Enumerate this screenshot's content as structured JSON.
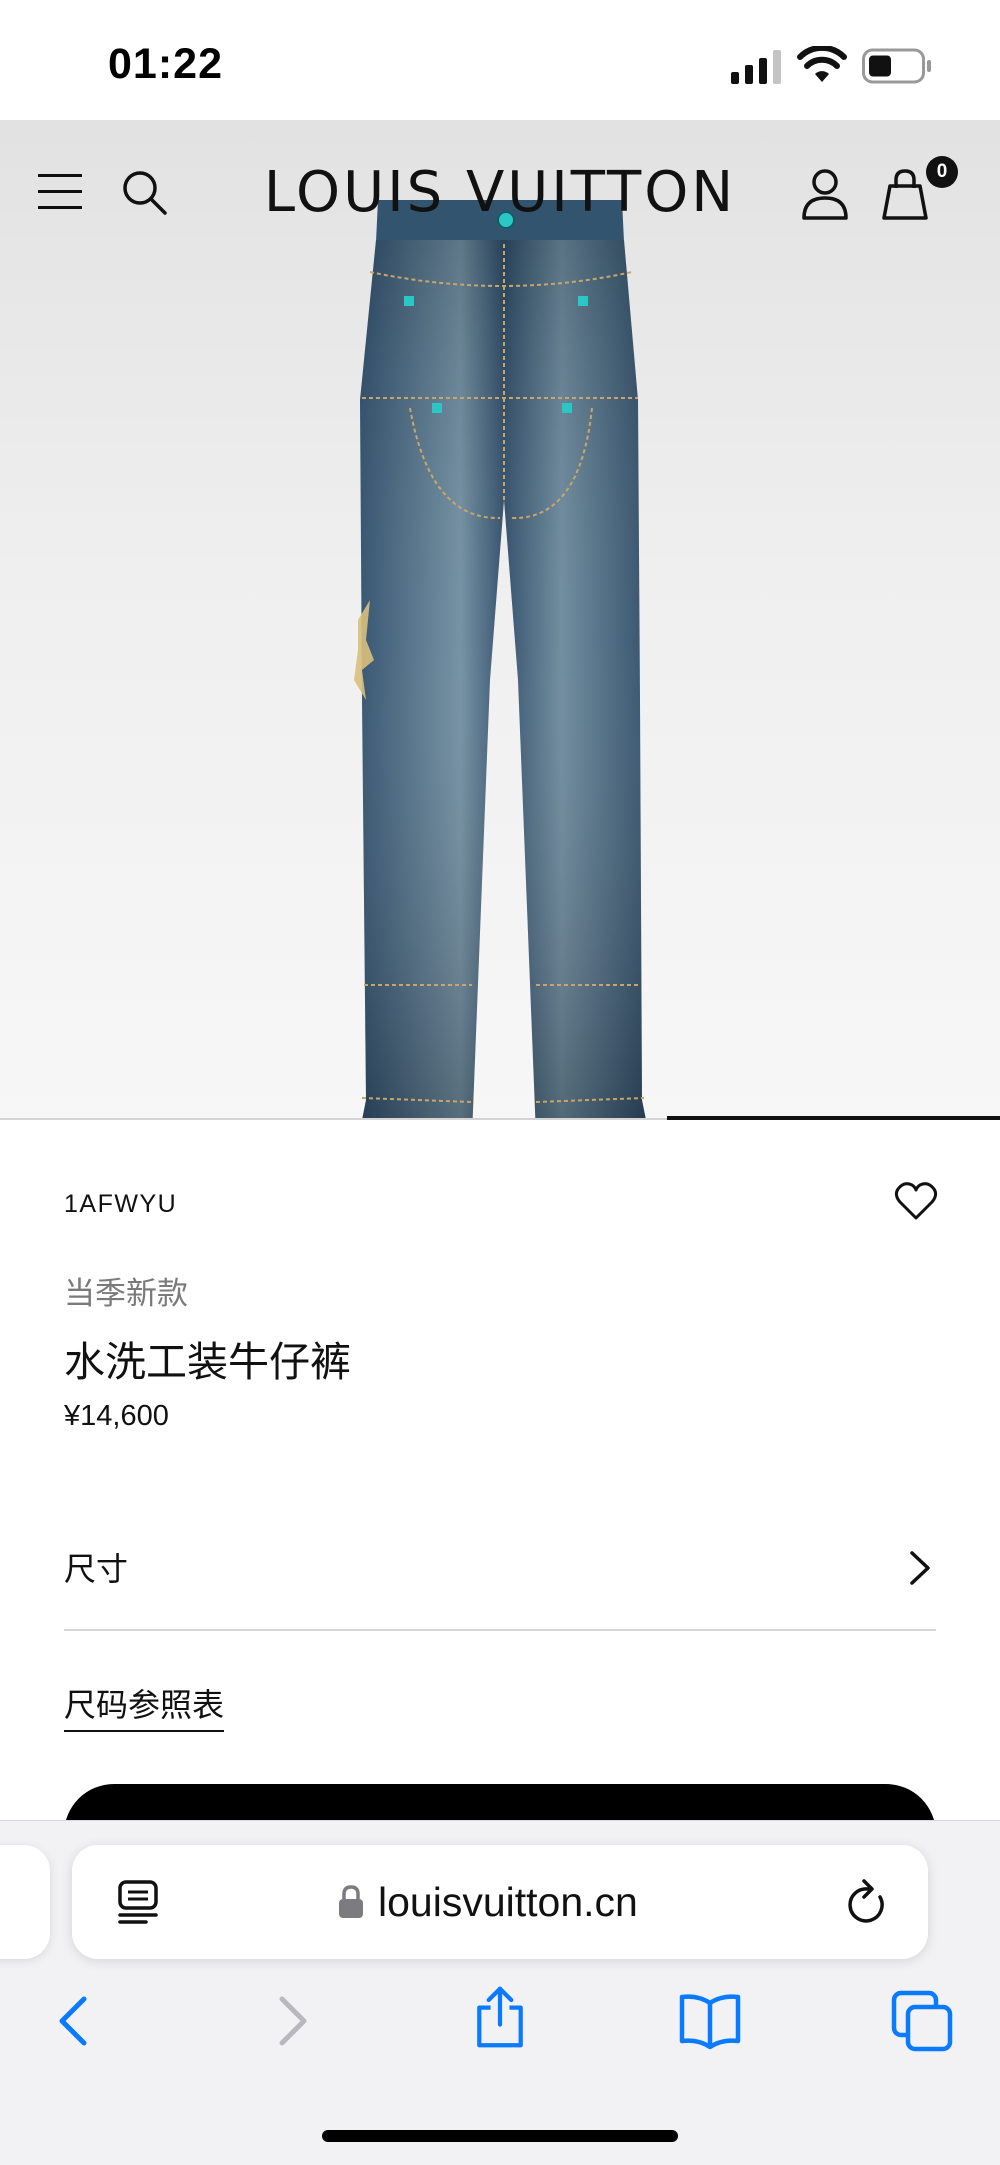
{
  "status_bar": {
    "time": "01:22"
  },
  "header": {
    "brand": "LOUIS VUITTON",
    "bag_count": "0",
    "icons": [
      "menu-icon",
      "search-icon",
      "account-icon",
      "shopping-bag-icon"
    ]
  },
  "hero": {
    "image": "denim-jeans-product-photo",
    "carousel_position": "2 of 3"
  },
  "product": {
    "sku": "1AFWYU",
    "badge": "当季新款",
    "name": "水洗工装牛仔裤",
    "price": "¥14,600",
    "size_label": "尺寸",
    "size_guide": "尺码参照表"
  },
  "browser": {
    "url": "louisvuitton.cn",
    "icons": [
      "reader-icon",
      "lock-icon",
      "reload-icon",
      "back-icon",
      "forward-icon",
      "share-icon",
      "bookmarks-icon",
      "tabs-icon"
    ]
  },
  "colors": {
    "brand_text": "#111111",
    "denim": "#3d5f7e",
    "accent_button": "#000000",
    "safari_blue": "#0a7aff"
  }
}
